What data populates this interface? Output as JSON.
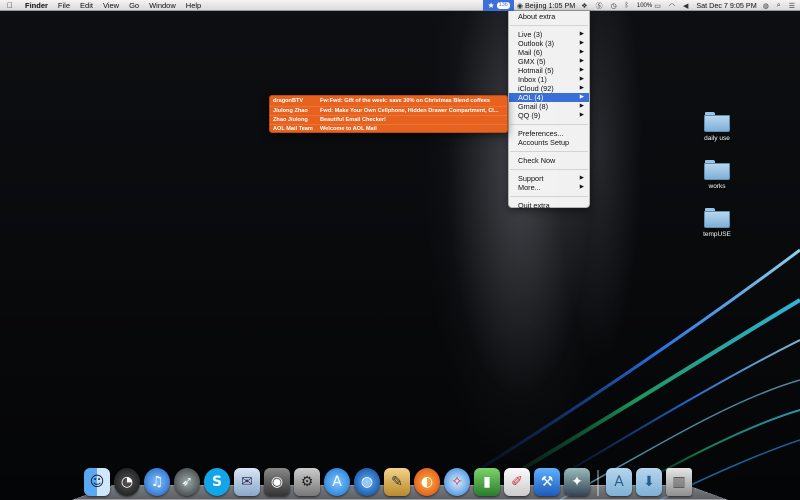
{
  "menubar": {
    "apple_icon": "apple-logo",
    "app_name": "Finder",
    "menus": [
      "File",
      "Edit",
      "View",
      "Go",
      "Window",
      "Help"
    ],
    "extra_badge": "136",
    "clock_city": "Beijing 1:05 PM",
    "battery": "100%",
    "datetime": "Sat Dec 7  9:05 PM"
  },
  "dropdown": {
    "about": "About extra",
    "accounts": [
      {
        "label": "Live (3)"
      },
      {
        "label": "Outlook (3)"
      },
      {
        "label": "Mail (6)"
      },
      {
        "label": "GMX (5)"
      },
      {
        "label": "Hotmail (5)"
      },
      {
        "label": "Inbox (1)"
      },
      {
        "label": "iCloud (92)"
      },
      {
        "label": "AOL (4)"
      },
      {
        "label": "Gmail (8)"
      },
      {
        "label": "QQ (9)"
      }
    ],
    "preferences": "Preferences...",
    "accounts_setup": "Accounts Setup",
    "check_now": "Check Now",
    "support": "Support",
    "more": "More...",
    "quit": "Quit extra"
  },
  "aol_messages": [
    {
      "sender": "dragonBTV",
      "subject": "Fw:Fwd: Gift of the week: save 30% on Christmas Blend coffees"
    },
    {
      "sender": "Jiulong Zhao",
      "subject": "Fwd: Make Your Own Cellphone, Hidden Drawer Compartment, Cl..."
    },
    {
      "sender": "Zhao Jiulong",
      "subject": "Beautiful Email Checker!"
    },
    {
      "sender": "AOL Mail Team",
      "subject": "Welcome to AOL Mail"
    }
  ],
  "desktop_folders": [
    {
      "label": "daily use"
    },
    {
      "label": "works"
    },
    {
      "label": "tempUSE"
    }
  ],
  "colors": {
    "menu_highlight": "#3a6fd8",
    "notification_orange": "#e8621f",
    "folder_blue": "#7eb0d6"
  },
  "dock_icons": [
    "finder-icon",
    "dashboard-icon",
    "itunes-icon",
    "launchpad-icon",
    "skype-icon",
    "mail-icon",
    "screen-recorder-icon",
    "system-preferences-icon",
    "app-store-icon",
    "google-earth-icon",
    "xcode-icon",
    "firefox-icon",
    "safari-icon",
    "activity-monitor-icon",
    "textedit-icon",
    "xcode-tools-icon",
    "instruments-icon",
    "applications-folder-icon",
    "downloads-folder-icon",
    "trash-icon"
  ]
}
